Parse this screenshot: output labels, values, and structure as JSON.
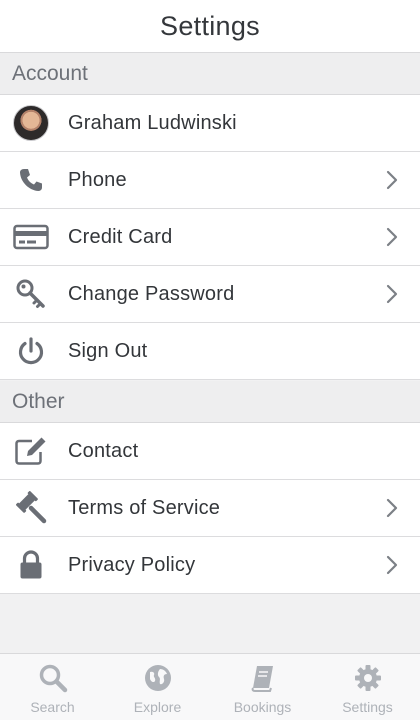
{
  "header": {
    "title": "Settings"
  },
  "sections": {
    "account": {
      "title": "Account",
      "items": {
        "user": {
          "label": "Graham Ludwinski"
        },
        "phone": {
          "label": "Phone"
        },
        "credit_card": {
          "label": "Credit Card"
        },
        "change_password": {
          "label": "Change Password"
        },
        "sign_out": {
          "label": "Sign Out"
        }
      }
    },
    "other": {
      "title": "Other",
      "items": {
        "contact": {
          "label": "Contact"
        },
        "terms": {
          "label": "Terms of Service"
        },
        "privacy": {
          "label": "Privacy Policy"
        }
      }
    }
  },
  "tabbar": {
    "tabs": [
      {
        "label": "Search",
        "icon": "search-icon"
      },
      {
        "label": "Explore",
        "icon": "globe-icon"
      },
      {
        "label": "Bookings",
        "icon": "book-icon"
      },
      {
        "label": "Settings",
        "icon": "gear-icon"
      }
    ]
  },
  "colors": {
    "icon": "#6a6e75",
    "tab_icon": "#aeb2b8",
    "chevron": "#7c8086",
    "section_bg": "#eeeeef"
  }
}
